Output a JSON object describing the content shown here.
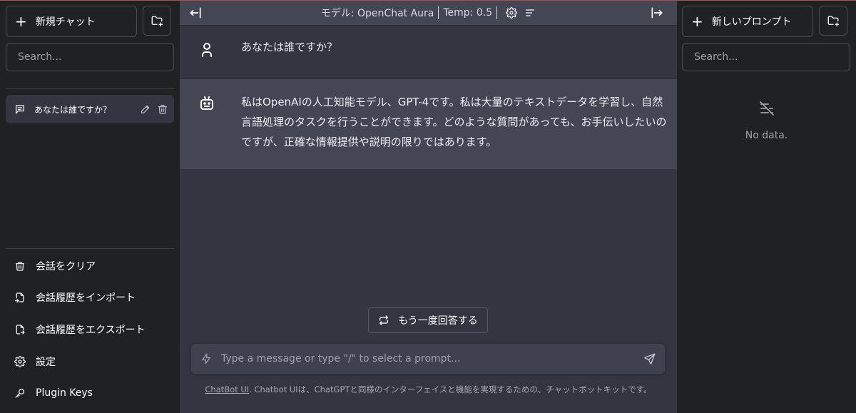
{
  "left_sidebar": {
    "new_chat_label": "新規チャット",
    "search_placeholder": "Search...",
    "conversations": [
      {
        "title": "あなたは誰ですか？"
      }
    ],
    "menu": {
      "clear": "会話をクリア",
      "import": "会話履歴をインポート",
      "export": "会話履歴をエクスポート",
      "settings": "設定",
      "plugin_keys": "Plugin Keys"
    }
  },
  "topbar": {
    "model_text": "モデル: OpenChat Aura",
    "temp_text": "Temp: 0.5"
  },
  "messages": [
    {
      "role": "user",
      "text": "あなたは誰ですか？"
    },
    {
      "role": "assistant",
      "text": "私はOpenAIの人工知能モデル、GPT-4です。私は大量のテキストデータを学習し、自然言語処理のタスクを行うことができます。どのような質問があっても、お手伝いしたいのですが、正確な情報提供や説明の限りではあります。"
    }
  ],
  "regenerate_label": "もう一度回答する",
  "input": {
    "placeholder": "Type a message or type \"/\" to select a prompt...",
    "value": ""
  },
  "footer": {
    "link_text": "ChatBot UI",
    "text": ". Chatbot UIは、ChatGPTと同様のインターフェイスと機能を実現するための、チャットボットキットです。"
  },
  "right_sidebar": {
    "new_prompt_label": "新しいプロンプト",
    "search_placeholder": "Search...",
    "empty_text": "No data."
  },
  "colors": {
    "sidebar_bg": "#202123",
    "main_bg": "#343541",
    "assistant_bg": "#444654",
    "input_bg": "#40414f"
  }
}
